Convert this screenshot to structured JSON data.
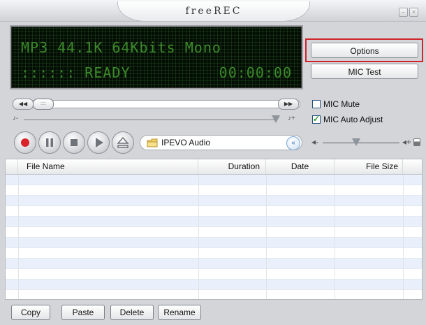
{
  "window": {
    "title": "freeREC"
  },
  "display": {
    "line1": "MP3 44.1K 64Kbits Mono",
    "status_prefix": "::::::",
    "status": "READY",
    "time": "00:00:00"
  },
  "controls": {
    "options_label": "Options",
    "mic_test_label": "MIC Test",
    "mic_mute_label": "MIC Mute",
    "mic_mute_checked": false,
    "mic_auto_adjust_label": "MIC Auto Adjust",
    "mic_auto_adjust_checked": true,
    "folder": "IPEVO Audio"
  },
  "table": {
    "columns": [
      "File Name",
      "Duration",
      "Date",
      "File Size"
    ],
    "rows": []
  },
  "actions": {
    "copy": "Copy",
    "paste": "Paste",
    "delete": "Delete",
    "rename": "Rename"
  },
  "colors": {
    "lcd_text": "#3c8a2a",
    "highlight": "#d0242c",
    "record": "#d8232a"
  }
}
